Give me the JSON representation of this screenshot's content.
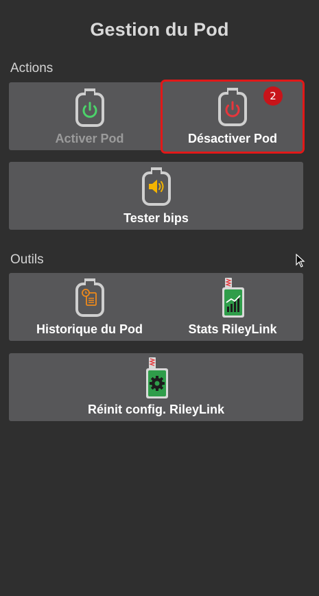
{
  "header": {
    "title": "Gestion du Pod"
  },
  "sections": {
    "actions": {
      "label": "Actions",
      "activate": {
        "label": "Activer Pod",
        "icon": "pod-power-green-icon",
        "enabled": false
      },
      "deactivate": {
        "label": "Désactiver Pod",
        "icon": "pod-power-red-icon",
        "badge": "2"
      },
      "test_beeps": {
        "label": "Tester bips",
        "icon": "pod-speaker-icon"
      }
    },
    "tools": {
      "label": "Outils",
      "pod_history": {
        "label": "Historique du Pod",
        "icon": "pod-history-icon"
      },
      "rileylink_stats": {
        "label": "Stats RileyLink",
        "icon": "rileylink-stats-icon"
      },
      "rileylink_reset": {
        "label": "Réinit config. RileyLink",
        "icon": "rileylink-config-icon"
      }
    }
  },
  "colors": {
    "background": "#2f2f2f",
    "tile": "#575759",
    "selected_outline": "#e21818",
    "power_on": "#4cd36a",
    "power_off": "#e8363c",
    "speaker": "#f4b400",
    "history": "#f08a1a",
    "rileylink_green": "#2f9d4a"
  }
}
